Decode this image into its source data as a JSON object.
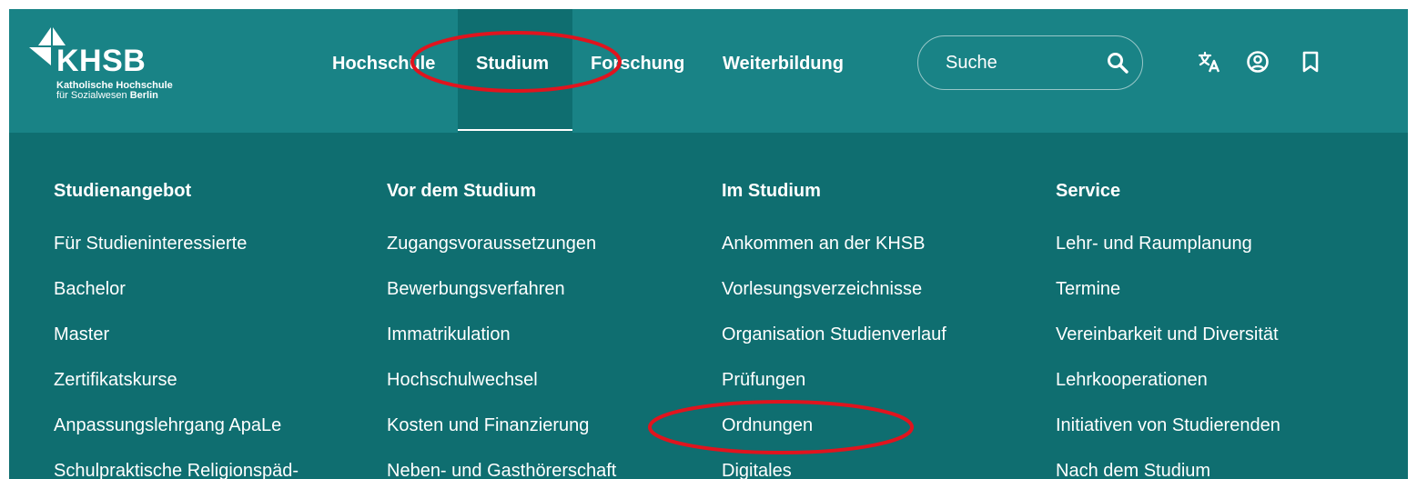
{
  "logo": {
    "word": "KHSB",
    "line1": "Katholische Hochschule",
    "line2_prefix": "für Sozialwesen ",
    "line2_bold": "Berlin"
  },
  "nav": {
    "items": [
      {
        "label": "Hochschule"
      },
      {
        "label": "Studium",
        "active": true
      },
      {
        "label": "Forschung"
      },
      {
        "label": "Weiterbildung"
      }
    ]
  },
  "search": {
    "placeholder": "Suche",
    "icon": "search-icon"
  },
  "tools": {
    "icons": [
      "translate-icon",
      "account-icon",
      "bookmark-icon"
    ]
  },
  "megamenu": {
    "columns": [
      {
        "heading": "Studienangebot",
        "links": [
          "Für Studieninteressierte",
          "Bachelor",
          "Master",
          "Zertifikatskurse",
          "Anpassungslehrgang ApaLe",
          "Schulpraktische Religionspäd-"
        ]
      },
      {
        "heading": "Vor dem Studium",
        "links": [
          "Zugangsvoraussetzungen",
          "Bewerbungsverfahren",
          "Immatrikulation",
          "Hochschulwechsel",
          "Kosten und Finanzierung",
          "Neben- und Gasthörerschaft"
        ]
      },
      {
        "heading": "Im Studium",
        "links": [
          "Ankommen an der KHSB",
          "Vorlesungsverzeichnisse",
          "Organisation Studienverlauf",
          "Prüfungen",
          "Ordnungen",
          "Digitales"
        ]
      },
      {
        "heading": "Service",
        "links": [
          "Lehr- und Raumplanung",
          "Termine",
          "Vereinbarkeit und Diversität",
          "Lehrkooperationen",
          "Initiativen von Studierenden",
          "Nach dem Studium"
        ]
      }
    ]
  },
  "colors": {
    "header": "#198386",
    "megamenu": "#0f6e70",
    "annotation": "#e0141e"
  }
}
